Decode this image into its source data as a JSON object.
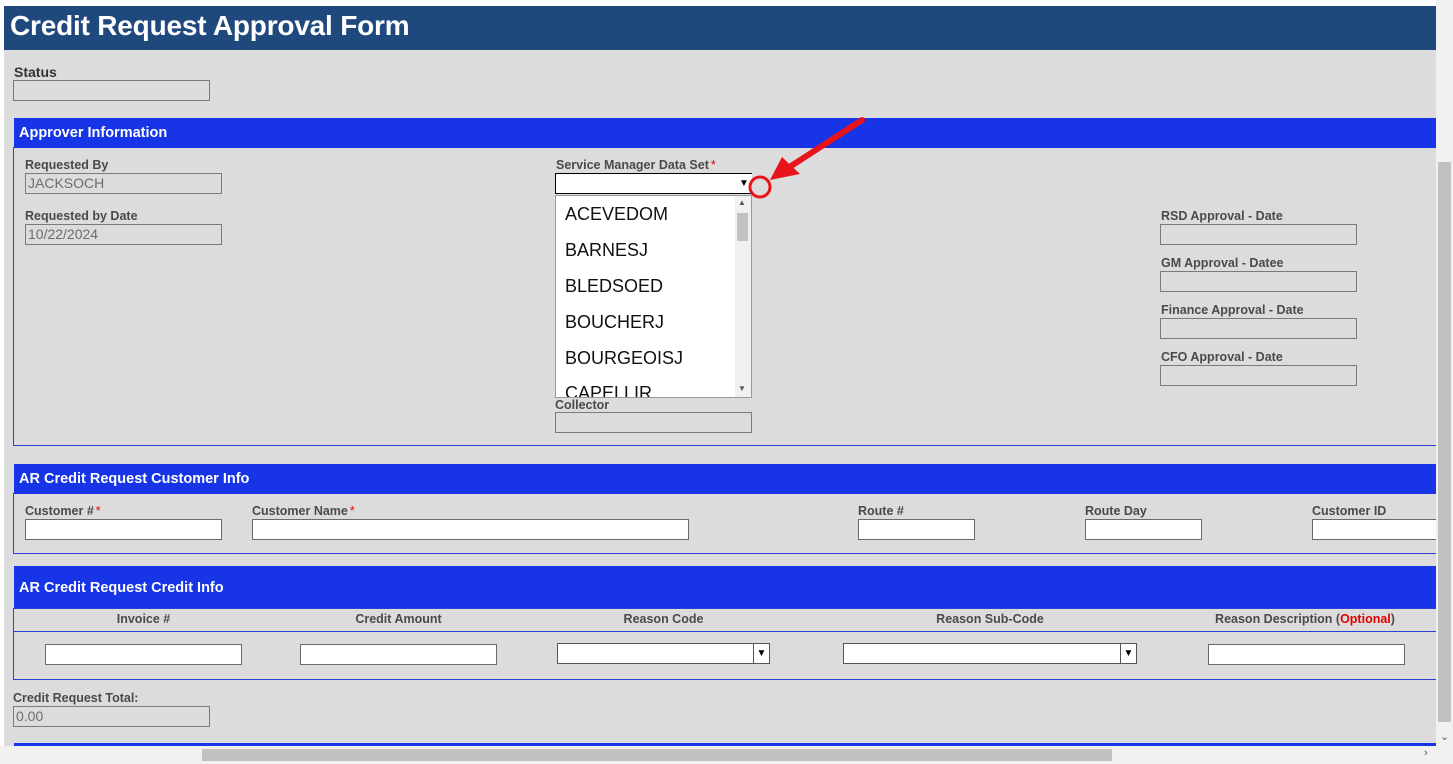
{
  "form": {
    "title": "Credit Request Approval Form",
    "status_label": "Status",
    "status_value": ""
  },
  "approver": {
    "section_title": "Approver Information",
    "requested_by_label": "Requested By",
    "requested_by_value": "JACKSOCH",
    "requested_by_date_label": "Requested by Date",
    "requested_by_date_value": "10/22/2024",
    "service_manager_label": "Service Manager Data Set",
    "required_mark": "*",
    "service_manager_value": "",
    "service_manager_options": [
      "ACEVEDOM",
      "BARNESJ",
      "BLEDSOED",
      "BOUCHERJ",
      "BOURGEOISJ",
      "CAPELLIR"
    ],
    "collector_label": "Collector",
    "collector_value": "",
    "rsd_label": "RSD Approval - Date",
    "gm_label": "GM Approval - Datee",
    "finance_label": "Finance Approval - Date",
    "cfo_label": "CFO Approval - Date"
  },
  "customer": {
    "section_title": "AR Credit Request Customer Info",
    "customer_num_label": "Customer #",
    "customer_name_label": "Customer Name",
    "route_num_label": "Route #",
    "route_day_label": "Route Day",
    "customer_id_label": "Customer ID"
  },
  "credit": {
    "section_title": "AR Credit Request Credit Info",
    "col_invoice": "Invoice #",
    "col_amount": "Credit Amount",
    "col_reason": "Reason Code",
    "col_subcode": "Reason Sub-Code",
    "col_description": "Reason Description (",
    "col_description_optional": "Optional",
    "col_description_close": ")",
    "total_label": "Credit Request Total:",
    "total_value": "0.00"
  },
  "annotation": {
    "color": "#e8141b",
    "icon": "red-arrow-pointing-to-dropdown"
  }
}
